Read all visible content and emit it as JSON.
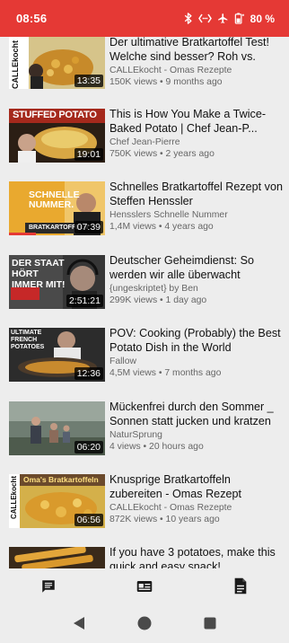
{
  "status_bar": {
    "time": "08:56",
    "battery": "80 %",
    "icons": [
      "bluetooth-icon",
      "nfc-icon",
      "airplane-mode-icon",
      "battery-saver-icon"
    ],
    "bg_color": "#e53935"
  },
  "videos": [
    {
      "title": "Der ultimative Bratkartoffel Test! Welche sind besser? Roh vs. Geko...",
      "channel": "CALLEkocht - Omas Rezepte",
      "stats": "150K views • 9 months ago",
      "duration": "13:35",
      "thumb_text": "CALLEkocht",
      "watched_fraction": 0
    },
    {
      "title": "This is How You Make a Twice-Baked Potato | Chef Jean-P...",
      "channel": "Chef Jean-Pierre",
      "stats": "750K views • 2 years ago",
      "duration": "19:01",
      "thumb_text": "STUFFED POTATO",
      "watched_fraction": 0
    },
    {
      "title": "Schnelles Bratkartoffel Rezept von Steffen Henssler",
      "channel": "Hensslers Schnelle Nummer",
      "stats": "1,4M views • 4 years ago",
      "duration": "07:39",
      "thumb_text": "SCHNELLE NUMMER.",
      "thumb_subtext": "BRATKARTOFFELN",
      "watched_fraction": 0.28
    },
    {
      "title": "Deutscher Geheimdienst: So werden wir alle überwacht (Hans-...",
      "channel": "{ungeskriptet} by Ben",
      "stats": "299K views • 1 day ago",
      "duration": "2:51:21",
      "thumb_text": "DER STAAT HÖRT IMMER MIT!",
      "watched_fraction": 0
    },
    {
      "title": "POV: Cooking (Probably) the Best Potato Dish in the World",
      "channel": "Fallow",
      "stats": "4,5M views • 7 months ago",
      "duration": "12:36",
      "thumb_text": "ULTIMATE FRENCH POTATOES",
      "watched_fraction": 0
    },
    {
      "title": "Mückenfrei durch den Sommer _ Sonnen statt jucken und kratzen _...",
      "channel": "NaturSprung",
      "stats": "4 views • 20 hours ago",
      "duration": "06:20",
      "thumb_text": "",
      "watched_fraction": 0
    },
    {
      "title": "Knusprige Bratkartoffeln zubereiten - Omas Rezept",
      "channel": "CALLEkocht - Omas Rezepte",
      "stats": "872K views • 10 years ago",
      "duration": "06:56",
      "thumb_text": "Oma's Bratkartoffeln",
      "thumb_subtext": "CALLEkocht",
      "watched_fraction": 0
    },
    {
      "title": "If you have 3 potatoes, make this quick and easy snack!",
      "channel": "",
      "stats": "",
      "duration": "",
      "thumb_text": "",
      "watched_fraction": 0
    }
  ],
  "bottom_nav": {
    "items": [
      "comments-icon",
      "video-details-icon",
      "description-icon"
    ],
    "selected_index": 1
  },
  "system_nav": [
    "back-icon",
    "home-icon",
    "recents-icon"
  ]
}
